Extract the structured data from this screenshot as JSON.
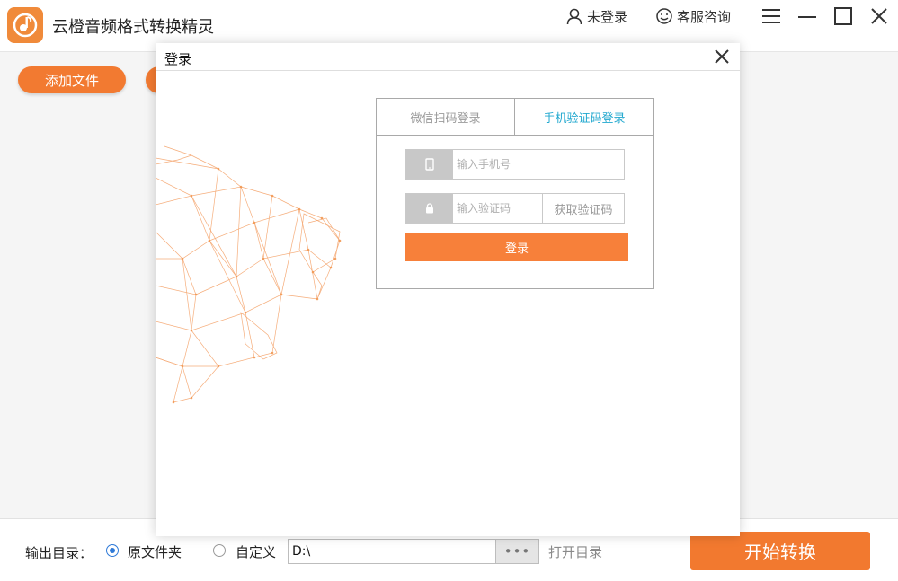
{
  "app": {
    "title": "云橙音频格式转换精灵",
    "user_label": "未登录",
    "support_label": "客服咨询",
    "accent_color": "#f27a31"
  },
  "toolbar": {
    "add_file_label": "添加文件"
  },
  "output": {
    "label": "输出目录：",
    "option_original": "原文件夹",
    "option_custom": "自定义",
    "selected": "原文件夹",
    "path_value": "D:\\",
    "browse_label": "•••",
    "open_dir_label": "打开目录",
    "start_label": "开始转换"
  },
  "login_modal": {
    "title": "登录",
    "tabs": [
      {
        "label": "微信扫码登录",
        "active": false
      },
      {
        "label": "手机验证码登录",
        "active": true
      }
    ],
    "phone_placeholder": "输入手机号",
    "code_placeholder": "输入验证码",
    "get_code_label": "获取验证码",
    "submit_label": "登录",
    "active_tab_color": "#22a8cf",
    "button_color": "#f7803a"
  },
  "icons": {
    "logo": "music-note-logo-icon",
    "user": "user-icon",
    "support": "smiley-icon",
    "menu": "hamburger-menu-icon",
    "minimize": "minimize-icon",
    "maximize": "maximize-icon",
    "close": "close-icon",
    "phone": "phone-icon",
    "lock": "lock-icon"
  }
}
